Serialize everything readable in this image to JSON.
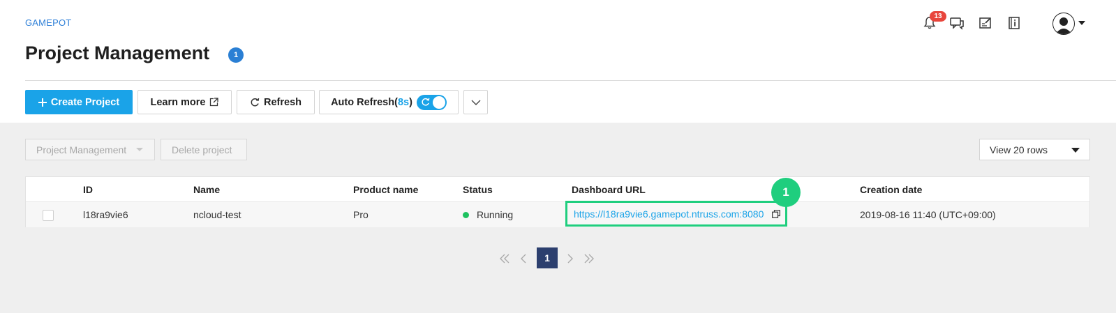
{
  "breadcrumb": "GAMEPOT",
  "page": {
    "title": "Project Management",
    "title_badge": "1"
  },
  "topbar": {
    "notification_count": "13"
  },
  "toolbar": {
    "create_label": "Create Project",
    "learn_label": "Learn more",
    "refresh_label": "Refresh",
    "auto_refresh_label": "Auto Refresh(",
    "auto_refresh_interval": "8s",
    "auto_refresh_close": ")",
    "auto_refresh_on": true
  },
  "actions": {
    "manage_label": "Project Management",
    "delete_label": "Delete project",
    "rows_label": "View 20 rows"
  },
  "table": {
    "columns": [
      "ID",
      "Name",
      "Product name",
      "Status",
      "Dashboard URL",
      "Creation date"
    ],
    "rows": [
      {
        "id": "l18ra9vie6",
        "name": "ncloud-test",
        "product": "Pro",
        "status": "Running",
        "url": "https://l18ra9vie6.gamepot.ntruss.com:8080",
        "created": "2019-08-16 11:40 (UTC+09:00)"
      }
    ]
  },
  "callout": "1",
  "pagination": {
    "current": "1"
  },
  "colors": {
    "accent": "#1aa3e8",
    "highlight": "#1fce7e",
    "status_running": "#1ec260",
    "badge": "#2a7fd4"
  }
}
